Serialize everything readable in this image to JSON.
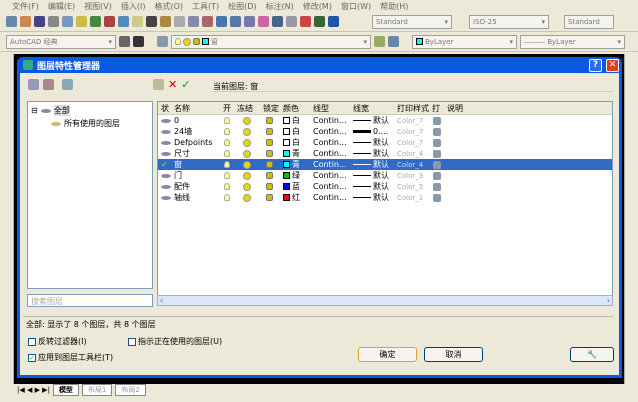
{
  "menu": [
    "文件(F)",
    "编辑(E)",
    "视图(V)",
    "插入(I)",
    "格式(O)",
    "工具(T)",
    "绘图(D)",
    "标注(N)",
    "修改(M)",
    "窗口(W)",
    "帮助(H)"
  ],
  "toolbar": {
    "text_style": "Standard",
    "dim_style": "ISO-25",
    "table_style": "Standard",
    "workspace": "AutoCAD 经典",
    "layer_combo": "窗",
    "color": "ByLayer",
    "linetype": "ByLayer"
  },
  "dialog": {
    "title": "图层特性管理器",
    "current_layer_label": "当前图层: 窗",
    "tree": {
      "root": "全部",
      "child": "所有使用的图层"
    },
    "search_placeholder": "搜索图层",
    "columns": [
      "状",
      "名称",
      "开",
      "冻结",
      "锁定",
      "颜色",
      "线型",
      "线宽",
      "打印样式",
      "打",
      "说明"
    ],
    "layers": [
      {
        "name": "0",
        "color": "白",
        "hex": "#ffffff",
        "linetype": "Contin...",
        "lineweight": "默认",
        "plot_style": "Color_7",
        "selected": false
      },
      {
        "name": "24墙",
        "color": "白",
        "hex": "#ffffff",
        "linetype": "Contin...",
        "lineweight": "0....",
        "plot_style": "Color_7",
        "selected": false
      },
      {
        "name": "Defpoints",
        "color": "白",
        "hex": "#ffffff",
        "linetype": "Contin...",
        "lineweight": "默认",
        "plot_style": "Color_7",
        "selected": false
      },
      {
        "name": "尺寸",
        "color": "青",
        "hex": "#00ffff",
        "linetype": "Contin...",
        "lineweight": "默认",
        "plot_style": "Color_4",
        "selected": false
      },
      {
        "name": "窗",
        "color": "青",
        "hex": "#00ffff",
        "linetype": "Contin...",
        "lineweight": "默认",
        "plot_style": "Color_4",
        "selected": true
      },
      {
        "name": "门",
        "color": "绿",
        "hex": "#00c000",
        "linetype": "Contin...",
        "lineweight": "默认",
        "plot_style": "Color_3",
        "selected": false
      },
      {
        "name": "配件",
        "color": "蓝",
        "hex": "#0000ff",
        "linetype": "Contin...",
        "lineweight": "默认",
        "plot_style": "Color_5",
        "selected": false
      },
      {
        "name": "轴线",
        "color": "红",
        "hex": "#ff0000",
        "linetype": "Contin...",
        "lineweight": "默认",
        "plot_style": "Color_1",
        "selected": false
      }
    ],
    "status": "全部: 显示了 8 个图层，共 8 个图层",
    "invert_filter": "反转过滤器(I)",
    "indicate_in_use": "指示正在使用的图层(U)",
    "apply_to_toolbar": "应用到图层工具栏(T)",
    "ok": "确定",
    "cancel": "取消"
  },
  "tabs": [
    "模型",
    "布局1",
    "布局2"
  ]
}
